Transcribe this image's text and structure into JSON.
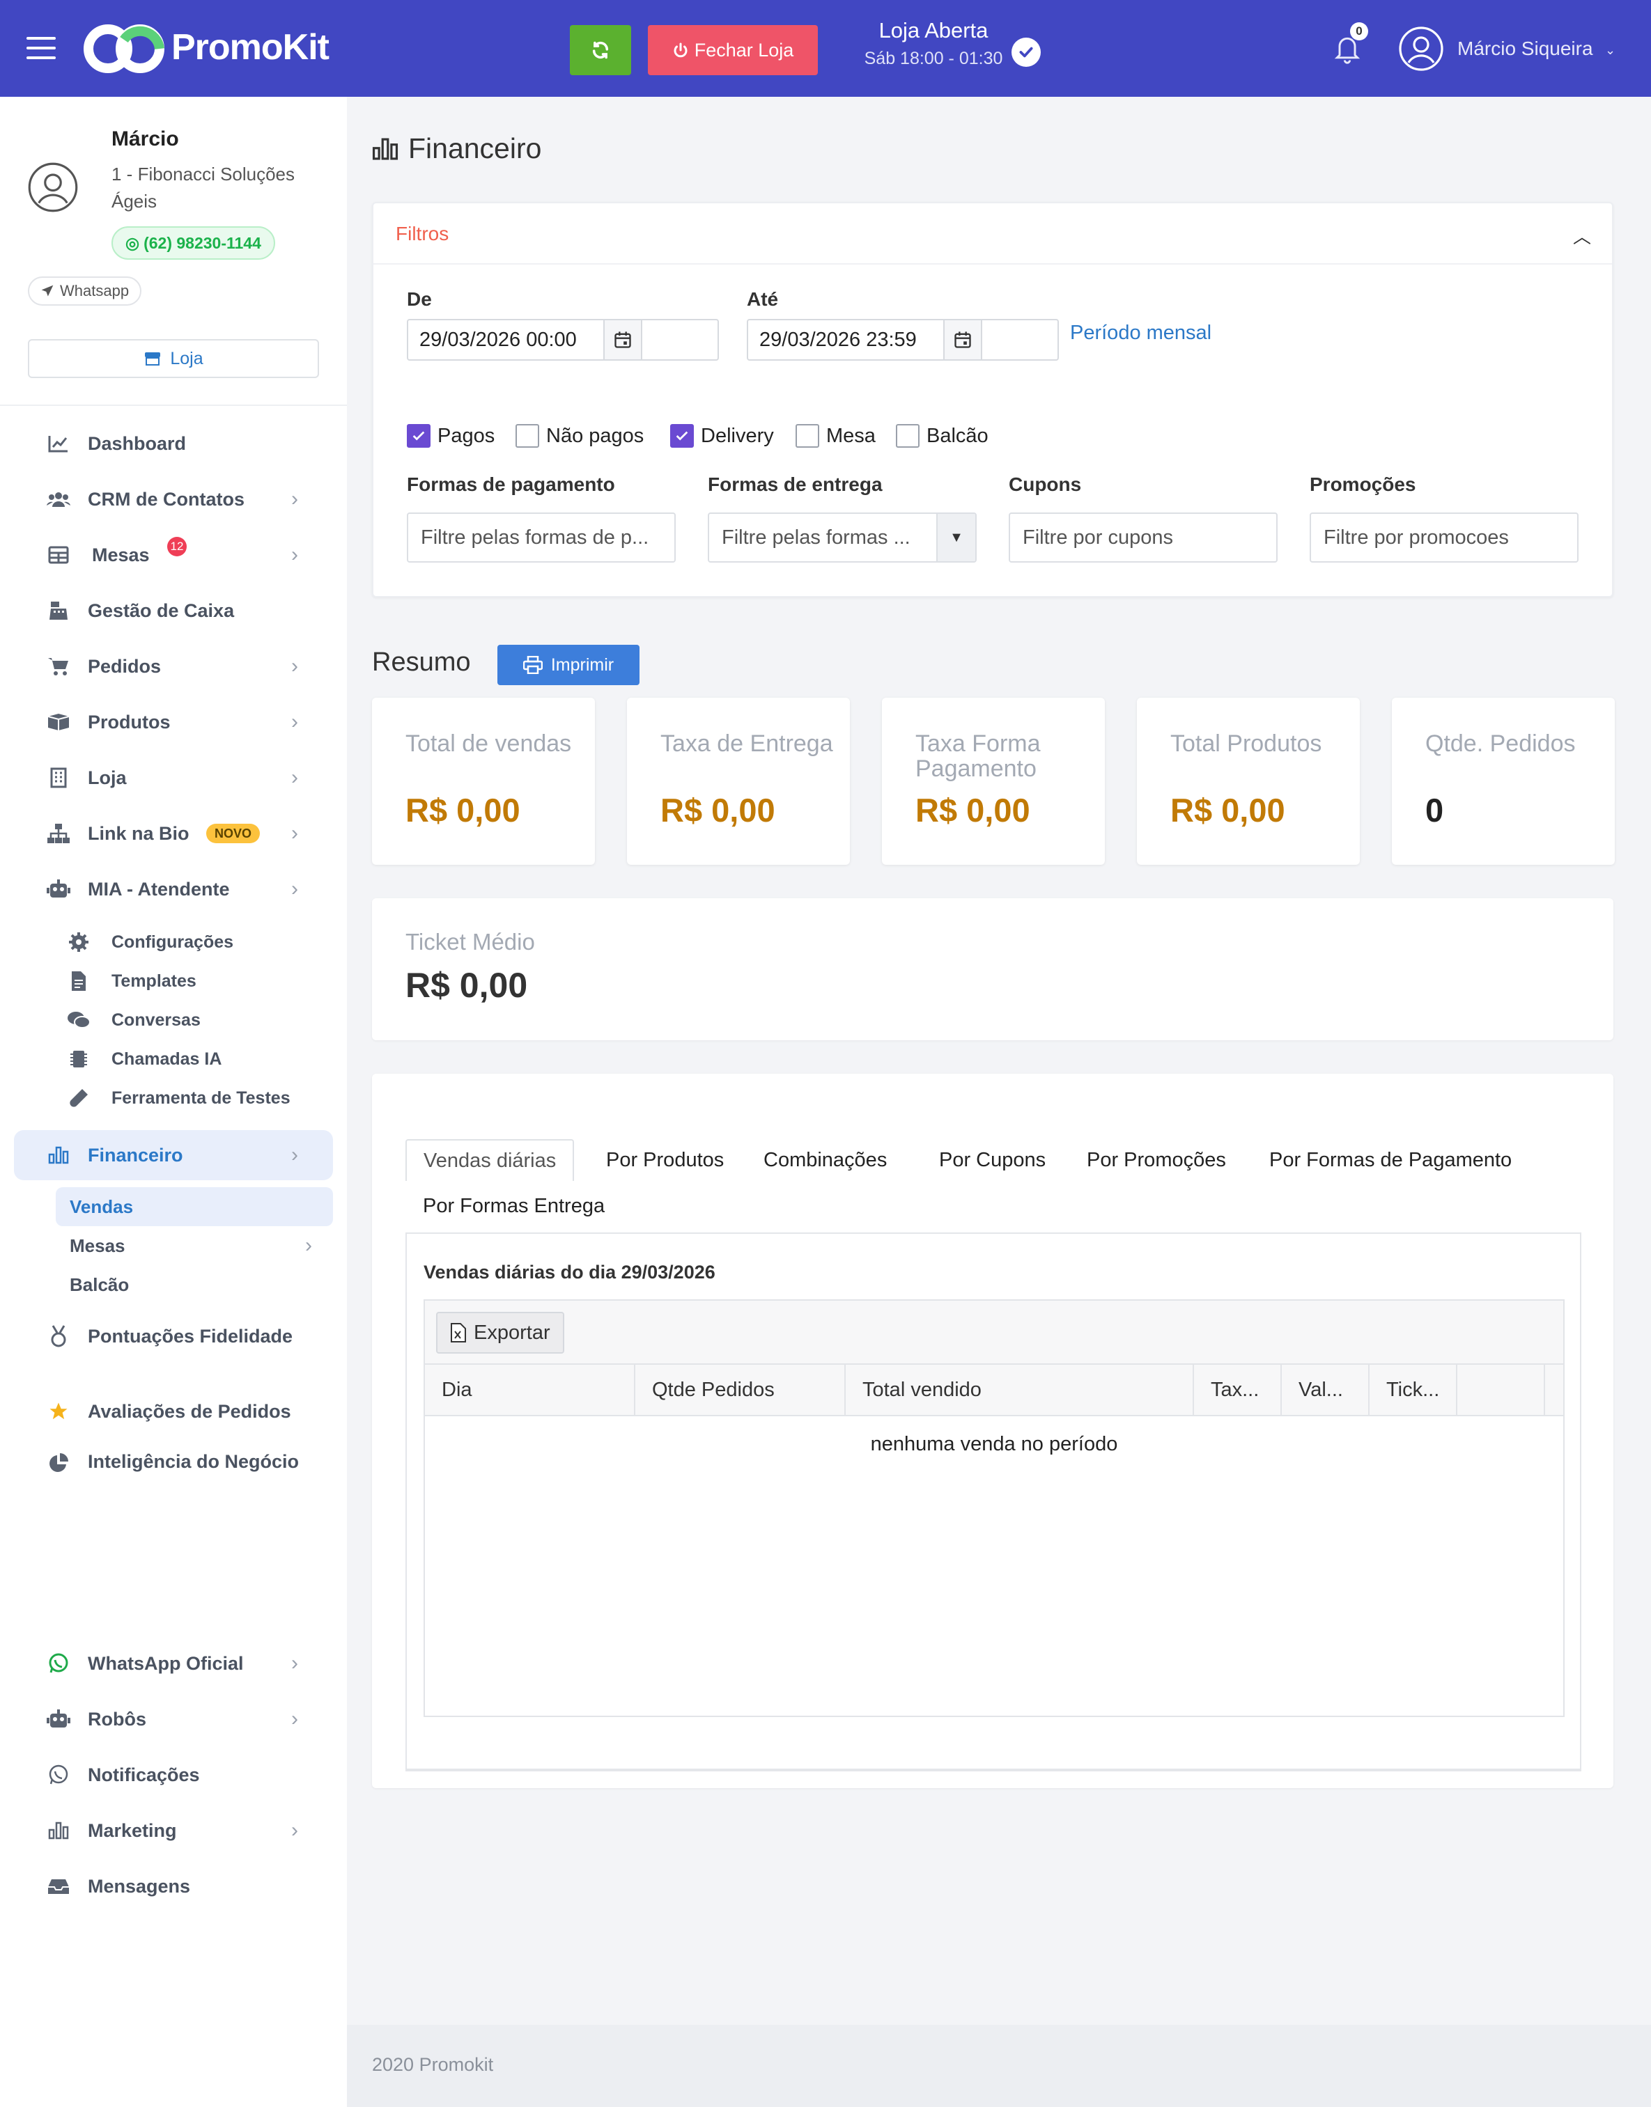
{
  "header": {
    "app_name": "PromoKit",
    "close_store_label": "Fechar Loja",
    "store_status": "Loja Aberta",
    "store_hours": "Sáb 18:00 - 01:30",
    "notifications_count": "0",
    "user_name": "Márcio Siqueira"
  },
  "sidebar": {
    "profile": {
      "name": "Márcio",
      "company": "1 - Fibonacci Soluções Ágeis",
      "phone": "(62) 98230-1144",
      "whatsapp_label": "Whatsapp",
      "store_button": "Loja"
    },
    "menu": [
      {
        "label": "Dashboard",
        "icon": "chart-line-icon"
      },
      {
        "label": "CRM de Contatos",
        "icon": "users-icon"
      },
      {
        "label": "Mesas",
        "icon": "table-icon",
        "badge": "12"
      },
      {
        "label": "Gestão de Caixa",
        "icon": "cash-register-icon"
      },
      {
        "label": "Pedidos",
        "icon": "cart-icon"
      },
      {
        "label": "Produtos",
        "icon": "boxes-icon"
      },
      {
        "label": "Loja",
        "icon": "building-icon"
      },
      {
        "label": "Link na Bio",
        "icon": "sitemap-icon",
        "badge": "NOVO"
      },
      {
        "label": "MIA - Atendente",
        "icon": "robot-icon"
      }
    ],
    "mia_sub": [
      {
        "label": "Configurações",
        "icon": "gear-icon"
      },
      {
        "label": "Templates",
        "icon": "file-icon"
      },
      {
        "label": "Conversas",
        "icon": "comments-icon"
      },
      {
        "label": "Chamadas IA",
        "icon": "chip-icon"
      },
      {
        "label": "Ferramenta de Testes",
        "icon": "vial-icon"
      }
    ],
    "financeiro": {
      "label": "Financeiro",
      "sub": [
        "Vendas",
        "Mesas",
        "Balcão"
      ]
    },
    "menu_bottom": [
      {
        "label": "Pontuações Fidelidade",
        "icon": "medal-icon"
      },
      {
        "label": "Avaliações de Pedidos",
        "icon": "star-icon"
      },
      {
        "label": "Inteligência do Negócio",
        "icon": "pie-chart-icon"
      },
      {
        "label": "WhatsApp Oficial",
        "icon": "whatsapp-icon"
      },
      {
        "label": "Robôs",
        "icon": "robot-icon"
      },
      {
        "label": "Notificações",
        "icon": "whatsapp-outline-icon"
      },
      {
        "label": "Marketing",
        "icon": "bar-chart-icon"
      },
      {
        "label": "Mensagens",
        "icon": "inbox-icon"
      }
    ]
  },
  "page": {
    "title": "Financeiro",
    "filters": {
      "title": "Filtros",
      "from_label": "De",
      "from_value": "29/03/2026 00:00",
      "to_label": "Até",
      "to_value": "29/03/2026 23:59",
      "period_link": "Período mensal",
      "checkboxes": [
        {
          "label": "Pagos",
          "checked": true
        },
        {
          "label": "Não pagos",
          "checked": false
        },
        {
          "label": "Delivery",
          "checked": true
        },
        {
          "label": "Mesa",
          "checked": false
        },
        {
          "label": "Balcão",
          "checked": false
        }
      ],
      "payment_label": "Formas de pagamento",
      "payment_placeholder": "Filtre pelas formas de p...",
      "delivery_label": "Formas de entrega",
      "delivery_placeholder": "Filtre pelas formas ...",
      "coupons_label": "Cupons",
      "coupons_placeholder": "Filtre por cupons",
      "promos_label": "Promoções",
      "promos_placeholder": "Filtre por promocoes"
    },
    "summary": {
      "title": "Resumo",
      "print_label": "Imprimir",
      "stats": [
        {
          "label": "Total de vendas",
          "value": "R$ 0,00"
        },
        {
          "label": "Taxa de Entrega",
          "value": "R$ 0,00"
        },
        {
          "label": "Taxa Forma Pagamento",
          "value": "R$ 0,00"
        },
        {
          "label": "Total Produtos",
          "value": "R$ 0,00"
        },
        {
          "label": "Qtde. Pedidos",
          "value": "0"
        }
      ],
      "ticket_label": "Ticket Médio",
      "ticket_value": "R$ 0,00"
    },
    "report": {
      "tabs": [
        "Vendas diárias",
        "Por Produtos",
        "Combinações",
        "Por Cupons",
        "Por Promoções",
        "Por Formas de Pagamento",
        "Por Formas Entrega"
      ],
      "panel_title": "Vendas diárias do dia 29/03/2026",
      "export_label": "Exportar",
      "columns": [
        "Dia",
        "Qtde Pedidos",
        "Total vendido",
        "Tax...",
        "Val...",
        "Tick..."
      ],
      "empty_message": "nenhuma venda no período"
    },
    "footer": "2020 Promokit"
  },
  "colors": {
    "header_bg": "#4147c2",
    "accent": "#2b78c7",
    "refresh_btn": "#5bb12f",
    "close_btn": "#ef5468",
    "value_gold": "#c17a06",
    "checkbox_on": "#6a4ad2"
  }
}
